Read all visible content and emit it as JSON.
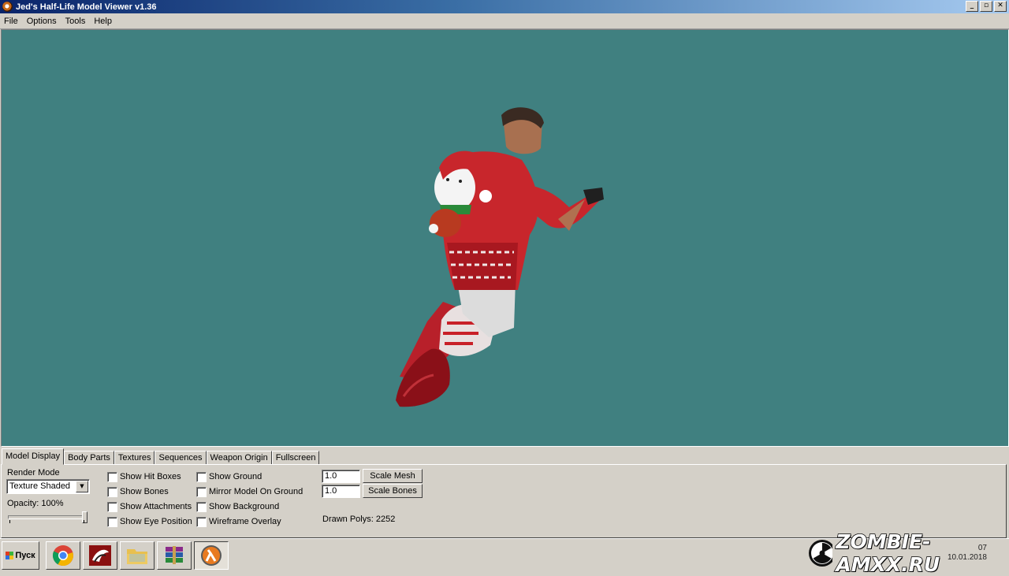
{
  "window": {
    "title": "Jed's Half-Life Model Viewer v1.36",
    "controls": {
      "minimize": "_",
      "restore": "▫",
      "close": "✕"
    }
  },
  "menu": [
    "File",
    "Options",
    "Tools",
    "Help"
  ],
  "viewport": {
    "background_color": "#408080"
  },
  "tabs": [
    {
      "label": "Model Display",
      "active": true
    },
    {
      "label": "Body Parts"
    },
    {
      "label": "Textures"
    },
    {
      "label": "Sequences"
    },
    {
      "label": "Weapon Origin"
    },
    {
      "label": "Fullscreen"
    }
  ],
  "model_display": {
    "render_mode_label": "Render Mode",
    "render_mode_value": "Texture Shaded",
    "opacity_label": "Opacity: 100%",
    "opacity_value": 1.0,
    "checkboxes_col1": [
      {
        "label": "Show Hit Boxes",
        "checked": false
      },
      {
        "label": "Show Bones",
        "checked": false
      },
      {
        "label": "Show Attachments",
        "checked": false
      },
      {
        "label": "Show Eye Position",
        "checked": false
      }
    ],
    "checkboxes_col2": [
      {
        "label": "Show Ground",
        "checked": false
      },
      {
        "label": "Mirror Model On Ground",
        "checked": false
      },
      {
        "label": "Show Background",
        "checked": false
      },
      {
        "label": "Wireframe Overlay",
        "checked": false
      }
    ],
    "scale_mesh_value": "1.0",
    "scale_mesh_button": "Scale Mesh",
    "scale_bones_value": "1.0",
    "scale_bones_button": "Scale Bones",
    "drawn_polys": "Drawn Polys: 2252"
  },
  "taskbar": {
    "start_label": "Пуск",
    "apps": [
      {
        "icon": "chrome-icon"
      },
      {
        "icon": "game-launcher-icon"
      },
      {
        "icon": "folder-icon"
      },
      {
        "icon": "winrar-icon"
      },
      {
        "icon": "half-life-icon",
        "active": true
      }
    ],
    "watermark": "ZOMBIE-AMXX.RU",
    "clock_time": "07",
    "clock_date": "10.01.2018"
  }
}
